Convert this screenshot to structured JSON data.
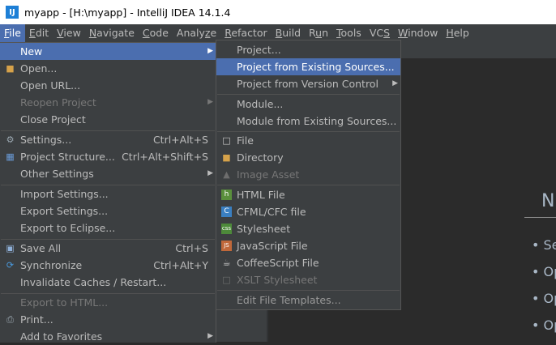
{
  "window": {
    "title": "myapp - [H:\\myapp] - IntelliJ IDEA 14.1.4"
  },
  "menubar": [
    {
      "pre": "",
      "ul": "F",
      "post": "ile",
      "active": true
    },
    {
      "pre": "",
      "ul": "E",
      "post": "dit"
    },
    {
      "pre": "",
      "ul": "V",
      "post": "iew"
    },
    {
      "pre": "",
      "ul": "N",
      "post": "avigate"
    },
    {
      "pre": "",
      "ul": "C",
      "post": "ode"
    },
    {
      "pre": "Analy",
      "ul": "z",
      "post": "e"
    },
    {
      "pre": "",
      "ul": "R",
      "post": "efactor"
    },
    {
      "pre": "",
      "ul": "B",
      "post": "uild"
    },
    {
      "pre": "R",
      "ul": "u",
      "post": "n"
    },
    {
      "pre": "",
      "ul": "T",
      "post": "ools"
    },
    {
      "pre": "VC",
      "ul": "S",
      "post": ""
    },
    {
      "pre": "",
      "ul": "W",
      "post": "indow"
    },
    {
      "pre": "",
      "ul": "H",
      "post": "elp"
    }
  ],
  "file_menu": {
    "new": "New",
    "open": "Open...",
    "open_url": "Open URL...",
    "reopen_project": "Reopen Project",
    "close_project": "Close Project",
    "settings": "Settings...",
    "settings_sc": "Ctrl+Alt+S",
    "project_structure": "Project Structure...",
    "project_structure_sc": "Ctrl+Alt+Shift+S",
    "other_settings": "Other Settings",
    "import_settings": "Import Settings...",
    "export_settings": "Export Settings...",
    "export_eclipse": "Export to Eclipse...",
    "save_all": "Save All",
    "save_all_sc": "Ctrl+S",
    "synchronize": "Synchronize",
    "synchronize_sc": "Ctrl+Alt+Y",
    "invalidate": "Invalidate Caches / Restart...",
    "export_html": "Export to HTML...",
    "print": "Print...",
    "add_favorites": "Add to Favorites"
  },
  "new_submenu": {
    "project": "Project...",
    "project_existing": "Project from Existing Sources...",
    "project_vcs": "Project from Version Control",
    "module": "Module...",
    "module_existing": "Module from Existing Sources...",
    "file": "File",
    "directory": "Directory",
    "image_asset": "Image Asset",
    "html_file": "HTML File",
    "cfml_file": "CFML/CFC file",
    "stylesheet": "Stylesheet",
    "javascript_file": "JavaScript File",
    "coffeescript_file": "CoffeeScript File",
    "xslt_stylesheet": "XSLT Stylesheet",
    "edit_templates": "Edit File Templates..."
  },
  "welcome": {
    "heading": "N",
    "bullets": [
      "• Se",
      "• Op",
      "• Op",
      "• Op"
    ]
  },
  "icon_names": [
    "intellij-app-icon",
    "folder-icon",
    "wrench-icon",
    "project-structure-icon",
    "save-icon",
    "sync-icon",
    "print-icon",
    "file-icon",
    "directory-icon",
    "android-icon",
    "html-icon",
    "cfml-icon",
    "css-icon",
    "javascript-icon",
    "coffeescript-icon",
    "xslt-icon"
  ],
  "colors": {
    "accent": "#4b6eaf",
    "menu_bg": "#3c3f41",
    "editor_bg": "#2b2b2b"
  }
}
